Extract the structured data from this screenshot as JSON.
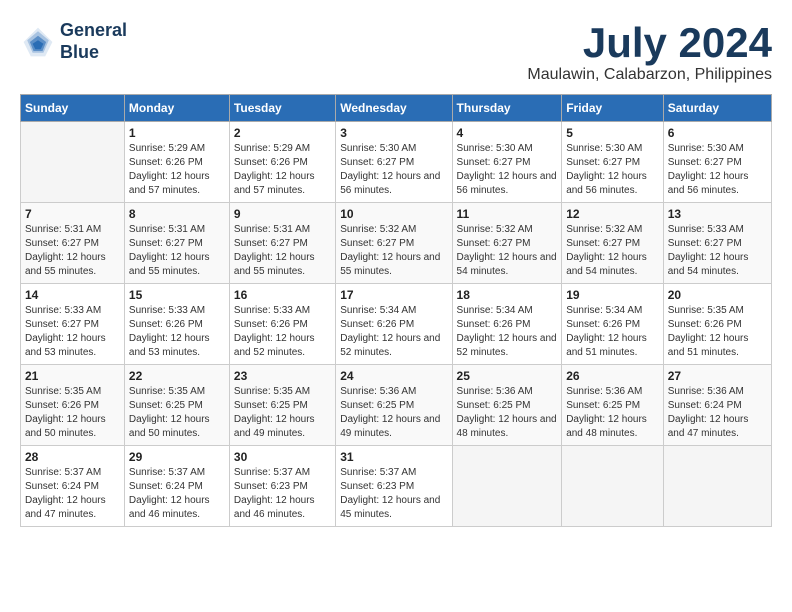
{
  "logo": {
    "line1": "General",
    "line2": "Blue"
  },
  "title": "July 2024",
  "location": "Maulawin, Calabarzon, Philippines",
  "days_of_week": [
    "Sunday",
    "Monday",
    "Tuesday",
    "Wednesday",
    "Thursday",
    "Friday",
    "Saturday"
  ],
  "weeks": [
    [
      {
        "num": "",
        "empty": true
      },
      {
        "num": "1",
        "sunrise": "5:29 AM",
        "sunset": "6:26 PM",
        "daylight": "12 hours and 57 minutes."
      },
      {
        "num": "2",
        "sunrise": "5:29 AM",
        "sunset": "6:26 PM",
        "daylight": "12 hours and 57 minutes."
      },
      {
        "num": "3",
        "sunrise": "5:30 AM",
        "sunset": "6:27 PM",
        "daylight": "12 hours and 56 minutes."
      },
      {
        "num": "4",
        "sunrise": "5:30 AM",
        "sunset": "6:27 PM",
        "daylight": "12 hours and 56 minutes."
      },
      {
        "num": "5",
        "sunrise": "5:30 AM",
        "sunset": "6:27 PM",
        "daylight": "12 hours and 56 minutes."
      },
      {
        "num": "6",
        "sunrise": "5:30 AM",
        "sunset": "6:27 PM",
        "daylight": "12 hours and 56 minutes."
      }
    ],
    [
      {
        "num": "7",
        "sunrise": "5:31 AM",
        "sunset": "6:27 PM",
        "daylight": "12 hours and 55 minutes."
      },
      {
        "num": "8",
        "sunrise": "5:31 AM",
        "sunset": "6:27 PM",
        "daylight": "12 hours and 55 minutes."
      },
      {
        "num": "9",
        "sunrise": "5:31 AM",
        "sunset": "6:27 PM",
        "daylight": "12 hours and 55 minutes."
      },
      {
        "num": "10",
        "sunrise": "5:32 AM",
        "sunset": "6:27 PM",
        "daylight": "12 hours and 55 minutes."
      },
      {
        "num": "11",
        "sunrise": "5:32 AM",
        "sunset": "6:27 PM",
        "daylight": "12 hours and 54 minutes."
      },
      {
        "num": "12",
        "sunrise": "5:32 AM",
        "sunset": "6:27 PM",
        "daylight": "12 hours and 54 minutes."
      },
      {
        "num": "13",
        "sunrise": "5:33 AM",
        "sunset": "6:27 PM",
        "daylight": "12 hours and 54 minutes."
      }
    ],
    [
      {
        "num": "14",
        "sunrise": "5:33 AM",
        "sunset": "6:27 PM",
        "daylight": "12 hours and 53 minutes."
      },
      {
        "num": "15",
        "sunrise": "5:33 AM",
        "sunset": "6:26 PM",
        "daylight": "12 hours and 53 minutes."
      },
      {
        "num": "16",
        "sunrise": "5:33 AM",
        "sunset": "6:26 PM",
        "daylight": "12 hours and 52 minutes."
      },
      {
        "num": "17",
        "sunrise": "5:34 AM",
        "sunset": "6:26 PM",
        "daylight": "12 hours and 52 minutes."
      },
      {
        "num": "18",
        "sunrise": "5:34 AM",
        "sunset": "6:26 PM",
        "daylight": "12 hours and 52 minutes."
      },
      {
        "num": "19",
        "sunrise": "5:34 AM",
        "sunset": "6:26 PM",
        "daylight": "12 hours and 51 minutes."
      },
      {
        "num": "20",
        "sunrise": "5:35 AM",
        "sunset": "6:26 PM",
        "daylight": "12 hours and 51 minutes."
      }
    ],
    [
      {
        "num": "21",
        "sunrise": "5:35 AM",
        "sunset": "6:26 PM",
        "daylight": "12 hours and 50 minutes."
      },
      {
        "num": "22",
        "sunrise": "5:35 AM",
        "sunset": "6:25 PM",
        "daylight": "12 hours and 50 minutes."
      },
      {
        "num": "23",
        "sunrise": "5:35 AM",
        "sunset": "6:25 PM",
        "daylight": "12 hours and 49 minutes."
      },
      {
        "num": "24",
        "sunrise": "5:36 AM",
        "sunset": "6:25 PM",
        "daylight": "12 hours and 49 minutes."
      },
      {
        "num": "25",
        "sunrise": "5:36 AM",
        "sunset": "6:25 PM",
        "daylight": "12 hours and 48 minutes."
      },
      {
        "num": "26",
        "sunrise": "5:36 AM",
        "sunset": "6:25 PM",
        "daylight": "12 hours and 48 minutes."
      },
      {
        "num": "27",
        "sunrise": "5:36 AM",
        "sunset": "6:24 PM",
        "daylight": "12 hours and 47 minutes."
      }
    ],
    [
      {
        "num": "28",
        "sunrise": "5:37 AM",
        "sunset": "6:24 PM",
        "daylight": "12 hours and 47 minutes."
      },
      {
        "num": "29",
        "sunrise": "5:37 AM",
        "sunset": "6:24 PM",
        "daylight": "12 hours and 46 minutes."
      },
      {
        "num": "30",
        "sunrise": "5:37 AM",
        "sunset": "6:23 PM",
        "daylight": "12 hours and 46 minutes."
      },
      {
        "num": "31",
        "sunrise": "5:37 AM",
        "sunset": "6:23 PM",
        "daylight": "12 hours and 45 minutes."
      },
      {
        "num": "",
        "empty": true
      },
      {
        "num": "",
        "empty": true
      },
      {
        "num": "",
        "empty": true
      }
    ]
  ]
}
